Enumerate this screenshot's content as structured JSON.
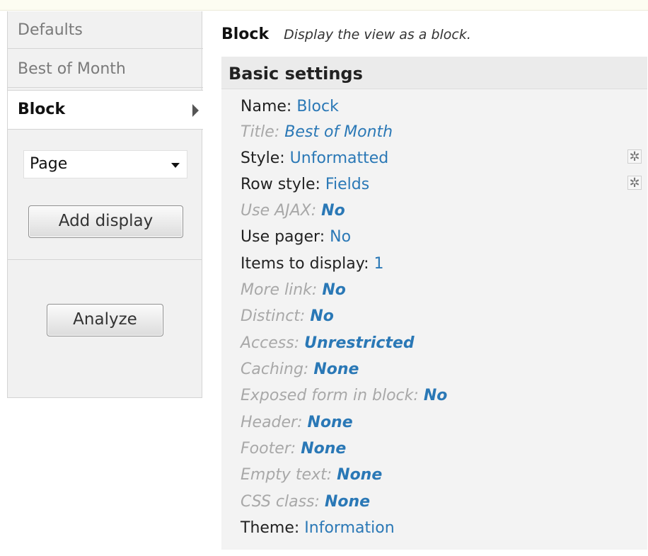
{
  "sidebar": {
    "tabs": [
      {
        "label": "Defaults"
      },
      {
        "label": "Best of Month"
      },
      {
        "label": "Block"
      }
    ],
    "display_type_select": {
      "value": "Page"
    },
    "add_display_label": "Add display",
    "analyze_label": "Analyze"
  },
  "main": {
    "display_name": "Block",
    "display_description": "Display the view as a block.",
    "section_title": "Basic settings",
    "settings": [
      {
        "label": "Name:",
        "value": "Block"
      },
      {
        "label": "Title:",
        "value": "Best of Month"
      },
      {
        "label": "Style:",
        "value": "Unformatted"
      },
      {
        "label": "Row style:",
        "value": "Fields"
      },
      {
        "label": "Use AJAX:",
        "value": "No"
      },
      {
        "label": "Use pager:",
        "value": "No"
      },
      {
        "label": "Items to display:",
        "value": "1"
      },
      {
        "label": "More link:",
        "value": "No"
      },
      {
        "label": "Distinct:",
        "value": "No"
      },
      {
        "label": "Access:",
        "value": "Unrestricted"
      },
      {
        "label": "Caching:",
        "value": "None"
      },
      {
        "label": "Exposed form in block:",
        "value": "No"
      },
      {
        "label": "Header:",
        "value": "None"
      },
      {
        "label": "Footer:",
        "value": "None"
      },
      {
        "label": "Empty text:",
        "value": "None"
      },
      {
        "label": "CSS class:",
        "value": "None"
      },
      {
        "label": "Theme:",
        "value": "Information"
      }
    ]
  },
  "icons": {
    "gear": "gear-icon",
    "arrow": "triangle-right-icon",
    "caret": "caret-down-icon"
  },
  "colors": {
    "link": "#2a78b6",
    "inherited_label": "#a8a8a8",
    "panel_bg": "#f3f3f3"
  }
}
